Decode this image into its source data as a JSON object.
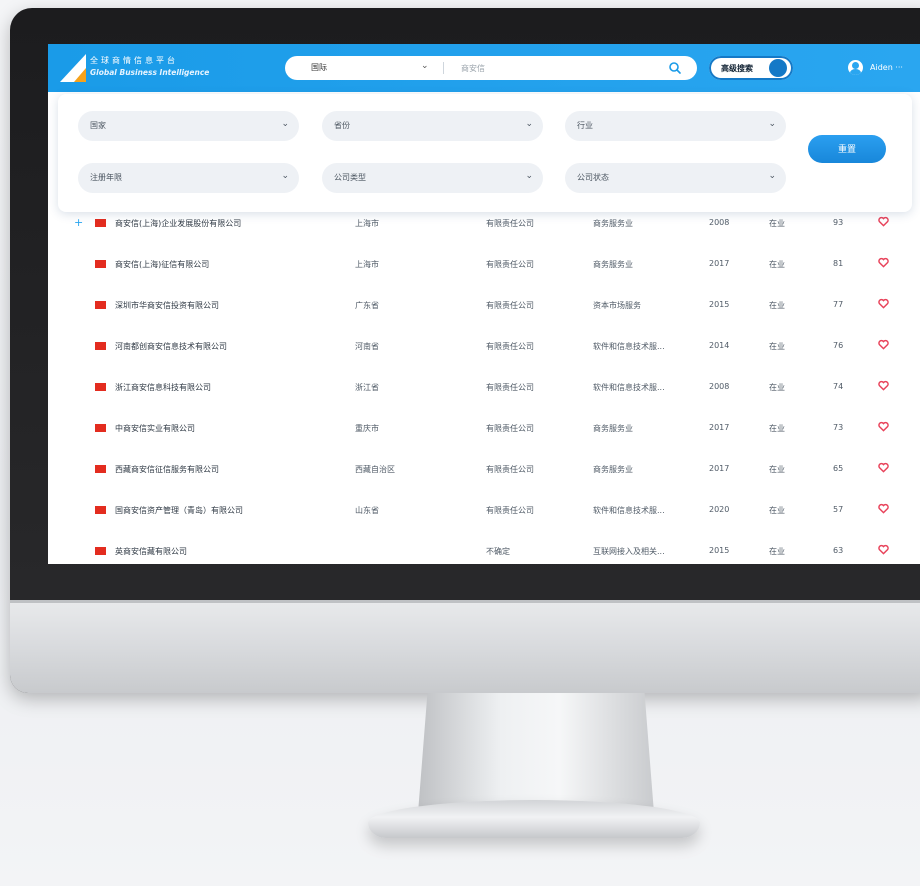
{
  "brand": {
    "title_cn": "全球商情信息平台",
    "title_en": "Global Business Intelligence",
    "accent": "#2aa6f0",
    "logo_accent": "#f5a21b"
  },
  "search": {
    "region_value": "国际",
    "placeholder": "商安信",
    "icon": "search-icon"
  },
  "advanced_search": {
    "label": "高级搜索",
    "toggle_on": true
  },
  "user": {
    "name": "Aiden",
    "icon": "user-avatar-icon"
  },
  "filters": {
    "country": "国家",
    "province": "省份",
    "industry": "行业",
    "reg_years": "注册年限",
    "company_type": "公司类型",
    "company_status": "公司状态",
    "reset_label": "重置"
  },
  "rows": [
    {
      "name": "商安信(上海)企业发展股份有限公司",
      "province": "上海市",
      "type": "有限责任公司",
      "industry": "商务服务业",
      "year": "2008",
      "status": "在业",
      "score": "93"
    },
    {
      "name": "商安信(上海)征信有限公司",
      "province": "上海市",
      "type": "有限责任公司",
      "industry": "商务服务业",
      "year": "2017",
      "status": "在业",
      "score": "81"
    },
    {
      "name": "深圳市华商安信投资有限公司",
      "province": "广东省",
      "type": "有限责任公司",
      "industry": "资本市场服务",
      "year": "2015",
      "status": "在业",
      "score": "77"
    },
    {
      "name": "河南都创商安信息技术有限公司",
      "province": "河南省",
      "type": "有限责任公司",
      "industry": "软件和信息技术服...",
      "year": "2014",
      "status": "在业",
      "score": "76"
    },
    {
      "name": "浙江商安信息科技有限公司",
      "province": "浙江省",
      "type": "有限责任公司",
      "industry": "软件和信息技术服...",
      "year": "2008",
      "status": "在业",
      "score": "74"
    },
    {
      "name": "中商安信实业有限公司",
      "province": "重庆市",
      "type": "有限责任公司",
      "industry": "商务服务业",
      "year": "2017",
      "status": "在业",
      "score": "73"
    },
    {
      "name": "西藏商安信征信服务有限公司",
      "province": "西藏自治区",
      "type": "有限责任公司",
      "industry": "商务服务业",
      "year": "2017",
      "status": "在业",
      "score": "65"
    },
    {
      "name": "国商安信资产管理（青岛）有限公司",
      "province": "山东省",
      "type": "有限责任公司",
      "industry": "软件和信息技术服...",
      "year": "2020",
      "status": "在业",
      "score": "57"
    },
    {
      "name": "英商安信藏有限公司",
      "province": "",
      "type": "不确定",
      "industry": "互联网接入及相关...",
      "year": "2015",
      "status": "在业",
      "score": "63"
    }
  ],
  "colors": {
    "flag": "#e32c1f",
    "favorite": "#e8425a",
    "expand": "#2aa6f0"
  }
}
